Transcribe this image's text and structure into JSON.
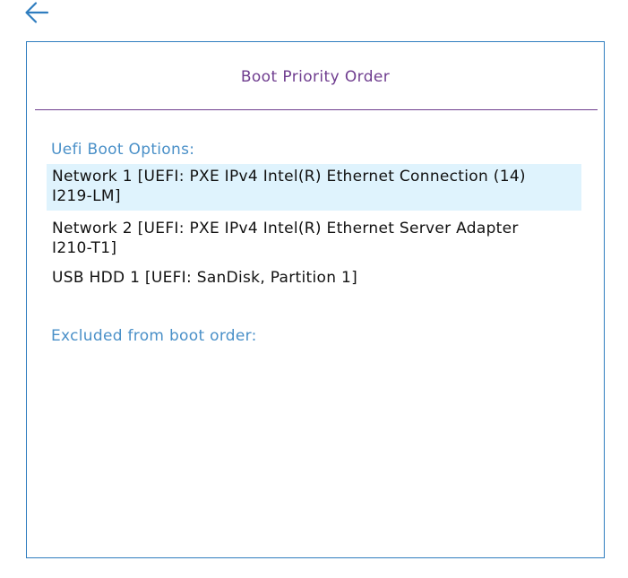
{
  "header": {
    "back_icon": "arrow-left-icon"
  },
  "dialog": {
    "title": "Boot Priority Order",
    "uefi_label": "Uefi Boot Options:",
    "boot_options": [
      {
        "label": "Network 1 [UEFI: PXE IPv4 Intel(R) Ethernet Connection (14) I219-LM]",
        "selected": true
      },
      {
        "label": "Network 2 [UEFI: PXE IPv4 Intel(R) Ethernet Server Adapter I210-T1]",
        "selected": false
      },
      {
        "label": "USB HDD 1 [UEFI: SanDisk, Partition 1]",
        "selected": false
      }
    ],
    "excluded_label": "Excluded from boot order:"
  },
  "colors": {
    "accent_blue": "#2f7dbf",
    "section_blue": "#4a90c8",
    "title_purple": "#6f3d8f",
    "selected_bg": "#dff3fd"
  }
}
